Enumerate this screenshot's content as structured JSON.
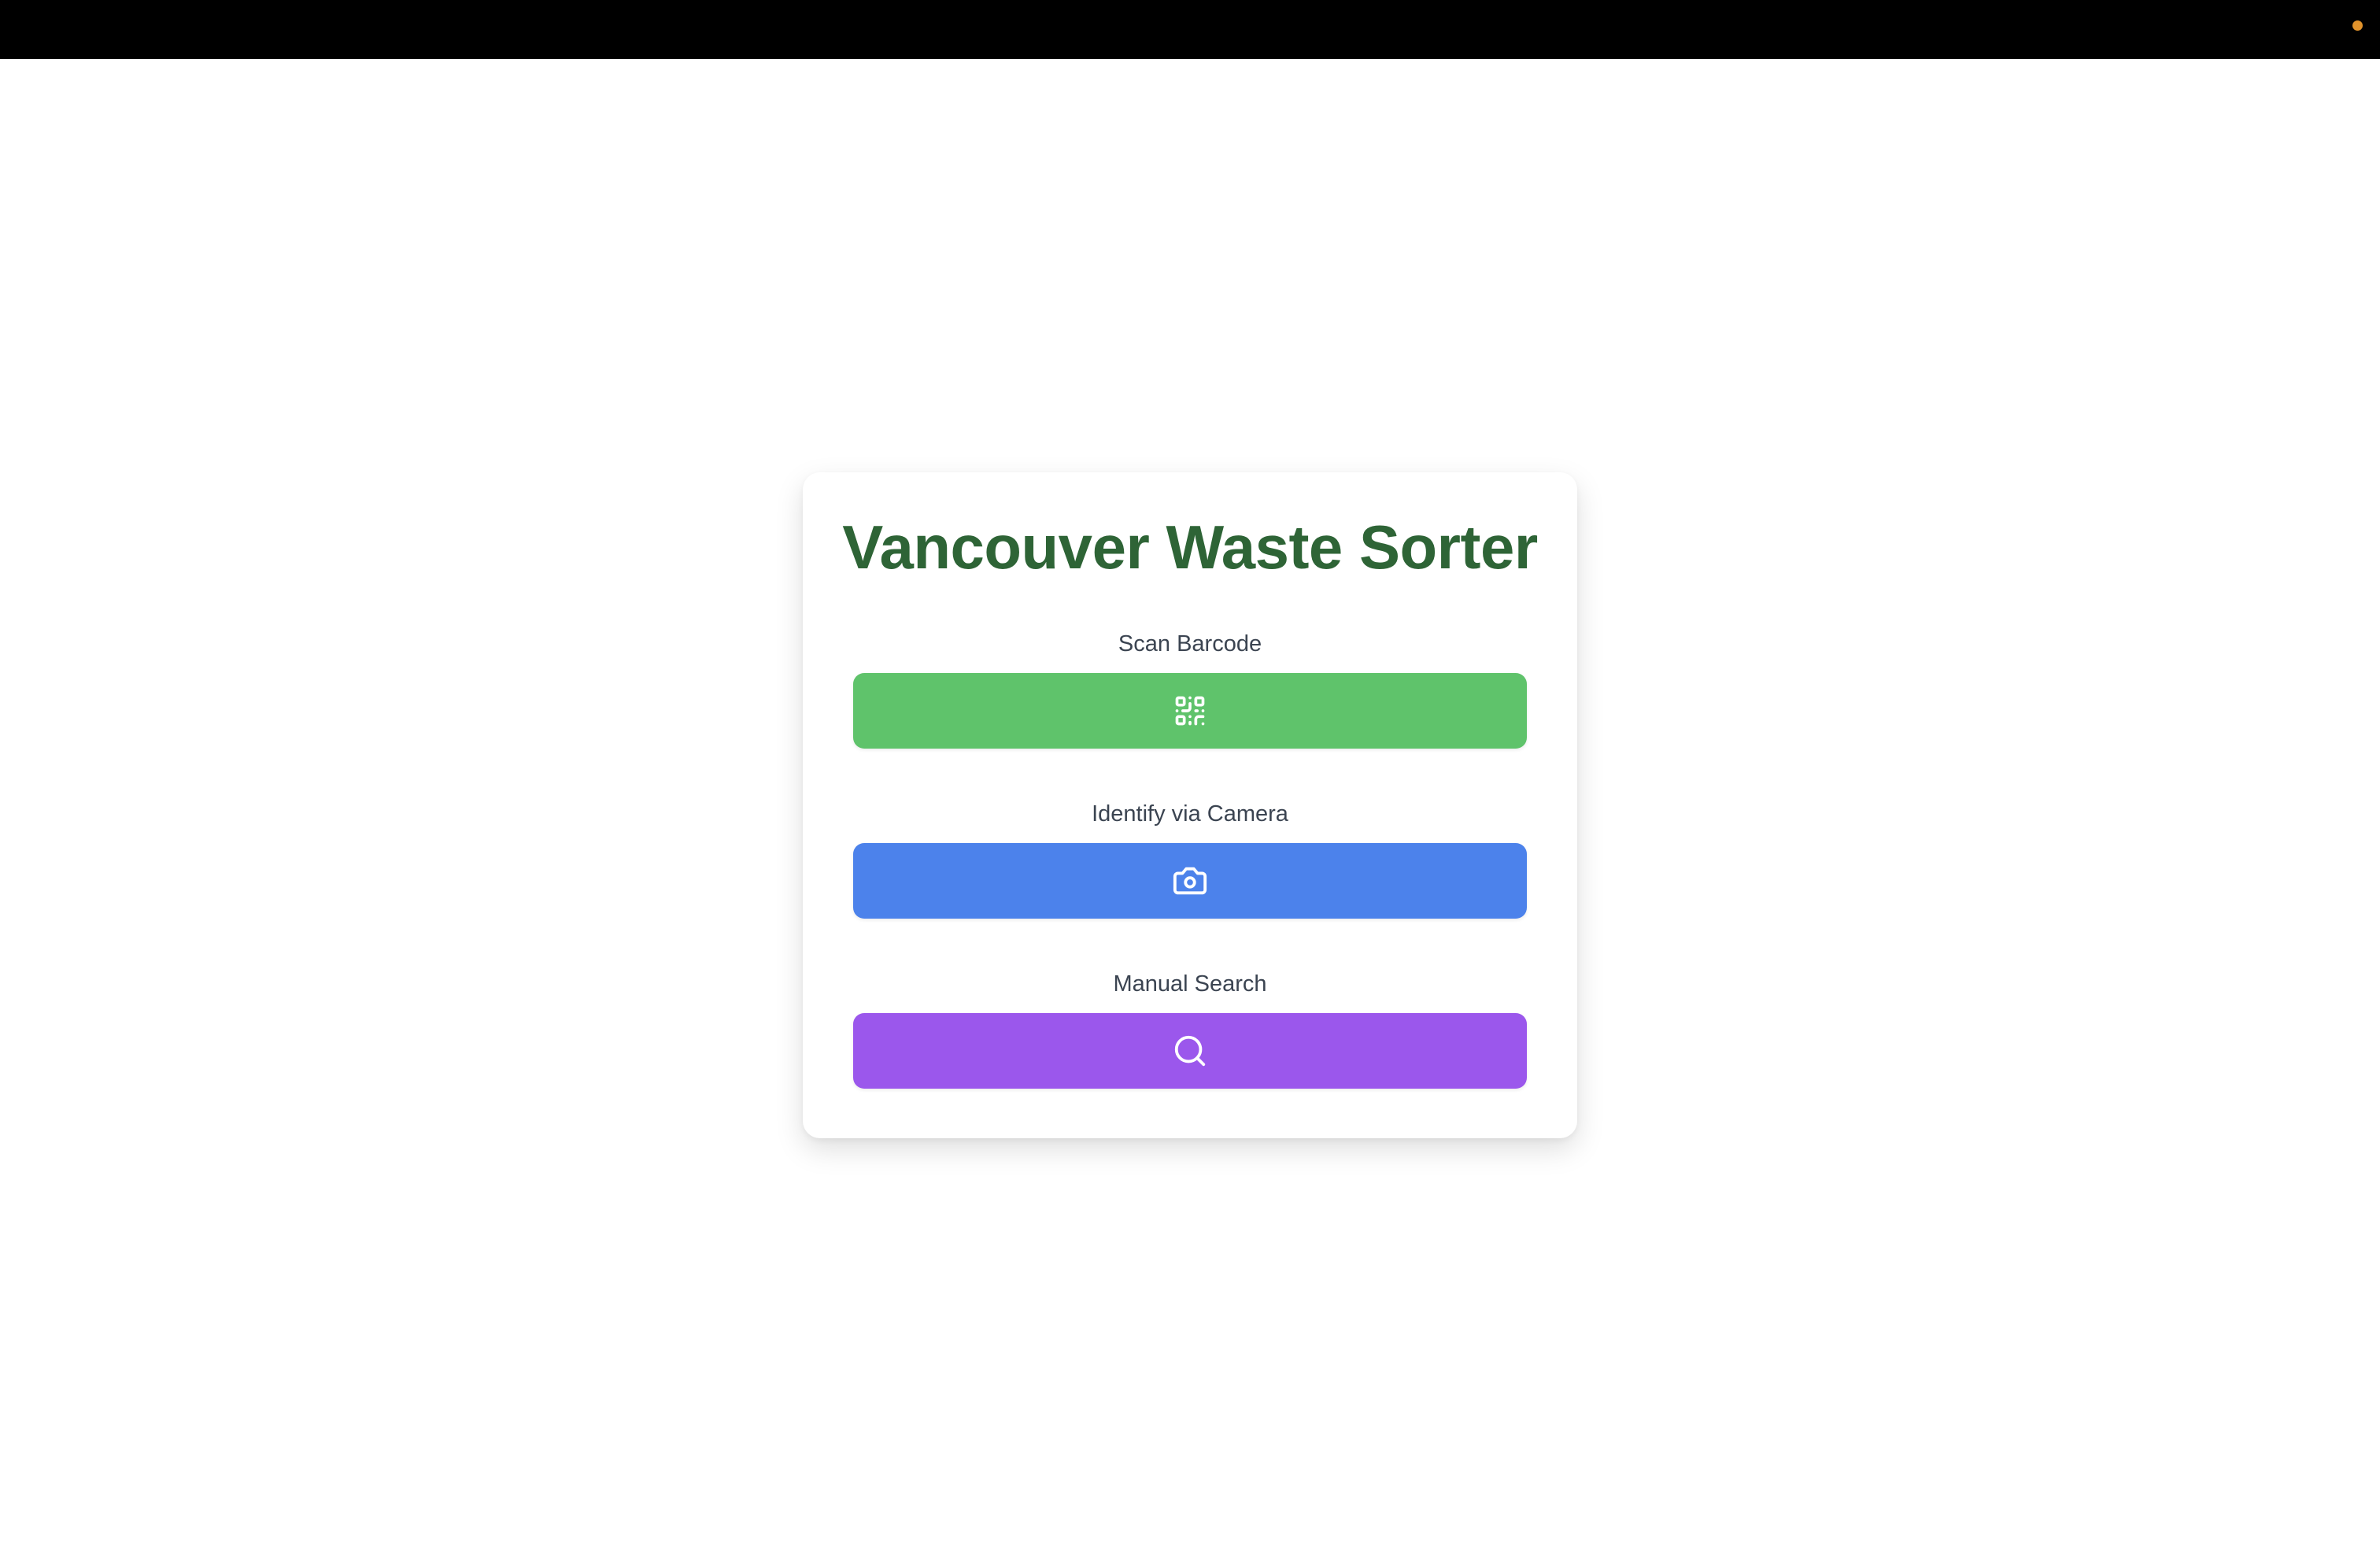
{
  "app": {
    "title": "Vancouver Waste Sorter"
  },
  "options": [
    {
      "label": "Scan Barcode",
      "icon": "qr-code-icon",
      "color": "#5fc36b"
    },
    {
      "label": "Identify via Camera",
      "icon": "camera-icon",
      "color": "#4c82eb"
    },
    {
      "label": "Manual Search",
      "icon": "search-icon",
      "color": "#9b57ec"
    }
  ],
  "colors": {
    "title": "#2e6436",
    "menubar": "#000000",
    "status_dot": "#e0922b"
  }
}
